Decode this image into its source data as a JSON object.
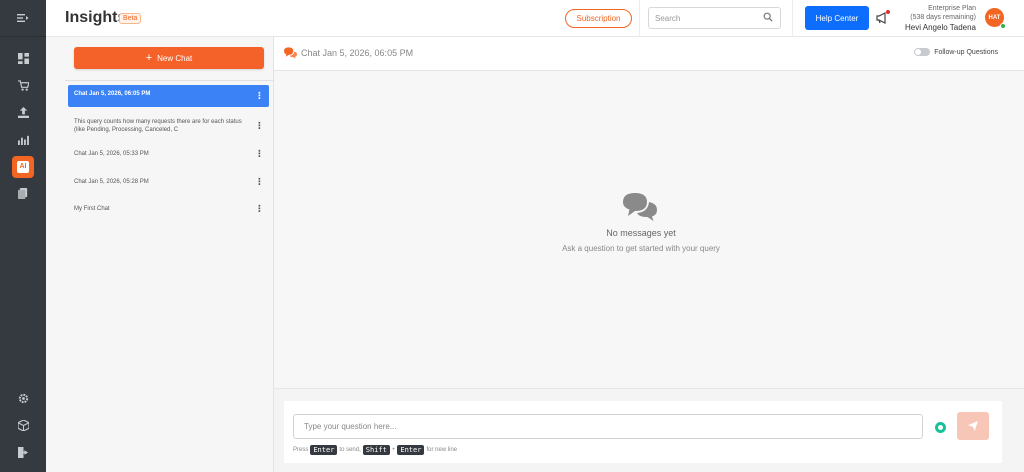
{
  "header": {
    "title": "Insights",
    "beta_badge": "Beta",
    "subscription_label": "Subscription",
    "search_placeholder": "Search",
    "help_label": "Help Center",
    "plan_name": "Enterprise Plan",
    "plan_remaining": "(538 days remaining)",
    "user_name": "Hevi Angelo Tadena",
    "avatar_initials": "HAT"
  },
  "sidebar": {
    "items": [
      {
        "icon": "dashboard-icon"
      },
      {
        "icon": "cart-icon"
      },
      {
        "icon": "upload-icon"
      },
      {
        "icon": "analytics-icon"
      },
      {
        "icon": "ai-icon",
        "label": "AI",
        "active": true
      },
      {
        "icon": "documents-icon"
      }
    ],
    "bottom_items": [
      {
        "icon": "settings-icon"
      },
      {
        "icon": "package-icon"
      },
      {
        "icon": "logout-icon"
      }
    ]
  },
  "chat_list": {
    "new_chat_label": "New Chat",
    "items": [
      {
        "label": "Chat Jan 5, 2026, 06:05 PM",
        "active": true
      },
      {
        "label": "This query counts how many requests there are for each status (like Pending, Processing, Canceled, C"
      },
      {
        "label": "Chat Jan 5, 2026, 05:33 PM"
      },
      {
        "label": "Chat Jan 5, 2026, 05:28 PM"
      },
      {
        "label": "My First Chat"
      }
    ]
  },
  "conversation": {
    "title": "Chat Jan 5, 2026, 06:05 PM",
    "followup_label": "Follow-up Questions",
    "empty_title": "No messages yet",
    "empty_subtitle": "Ask a question to get started with your query",
    "input_placeholder": "Type your question here...",
    "hint": {
      "press": "Press",
      "enter_key": "Enter",
      "to_send": "to send,",
      "shift_key": "Shift",
      "plus": "+",
      "enter_key_2": "Enter",
      "new_line": "for new line"
    }
  },
  "colors": {
    "accent": "#f26522",
    "primary_blue": "#0d6efd",
    "sidebar_bg": "#343a40"
  }
}
